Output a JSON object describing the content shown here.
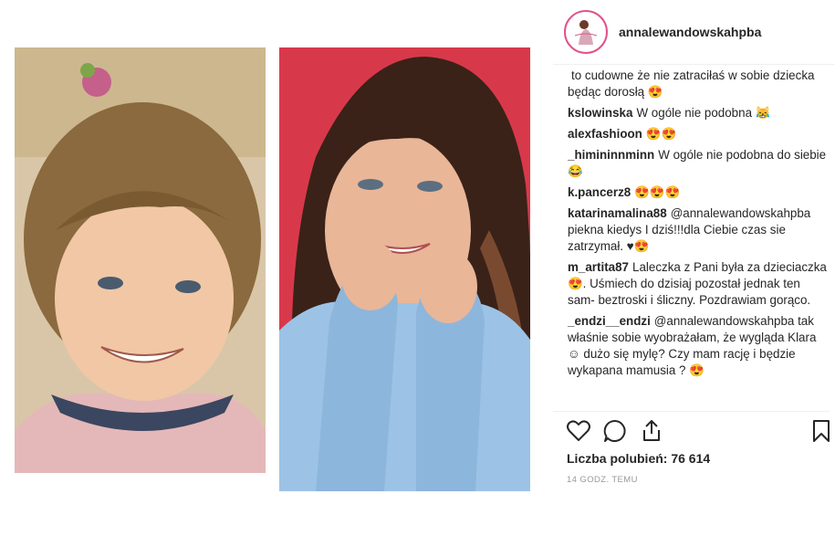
{
  "post": {
    "username": "annalewandowskahpba",
    "likes_label": "Liczba polubień:",
    "likes_count": "76 614",
    "timestamp": "14 GODZ. TEMU"
  },
  "comments": [
    {
      "user": "",
      "text": "to cudowne że nie zatraciłaś w sobie dziecka będąc dorosłą 😍"
    },
    {
      "user": "kslowinska",
      "text": "W ogóle nie podobna 😹"
    },
    {
      "user": "alexfashioon",
      "text": "😍😍"
    },
    {
      "user": "_himininnminn",
      "text": "W ogóle nie podobna do siebie😂"
    },
    {
      "user": "k.pancerz8",
      "text": "😍😍😍"
    },
    {
      "user": "katarinamalina88",
      "text": "@annalewandowskahpba piekna kiedys I dziś!!!dla Ciebie czas sie zatrzymał. ♥😍"
    },
    {
      "user": "m_artita87",
      "text": "Laleczka z Pani była za dzieciaczka😍. Uśmiech do dzisiaj pozostał jednak ten sam- beztroski i śliczny. Pozdrawiam gorąco."
    },
    {
      "user": "_endzi__endzi",
      "text": "@annalewandowskahpba tak właśnie sobie wyobrażałam, że wygląda Klara ☺ dużo się mylę? Czy mam rację i będzie wykapana mamusia ? 😍"
    }
  ],
  "icons": {
    "like": "heart-icon",
    "comment": "comment-bubble-icon",
    "share": "share-icon",
    "save": "bookmark-icon"
  },
  "colors": {
    "left_photo_bg": "#d9c6a8",
    "right_photo_bg": "#d8394a",
    "sweater_blue": "#9cc3e6",
    "avatar_ring": "#e0528a"
  }
}
